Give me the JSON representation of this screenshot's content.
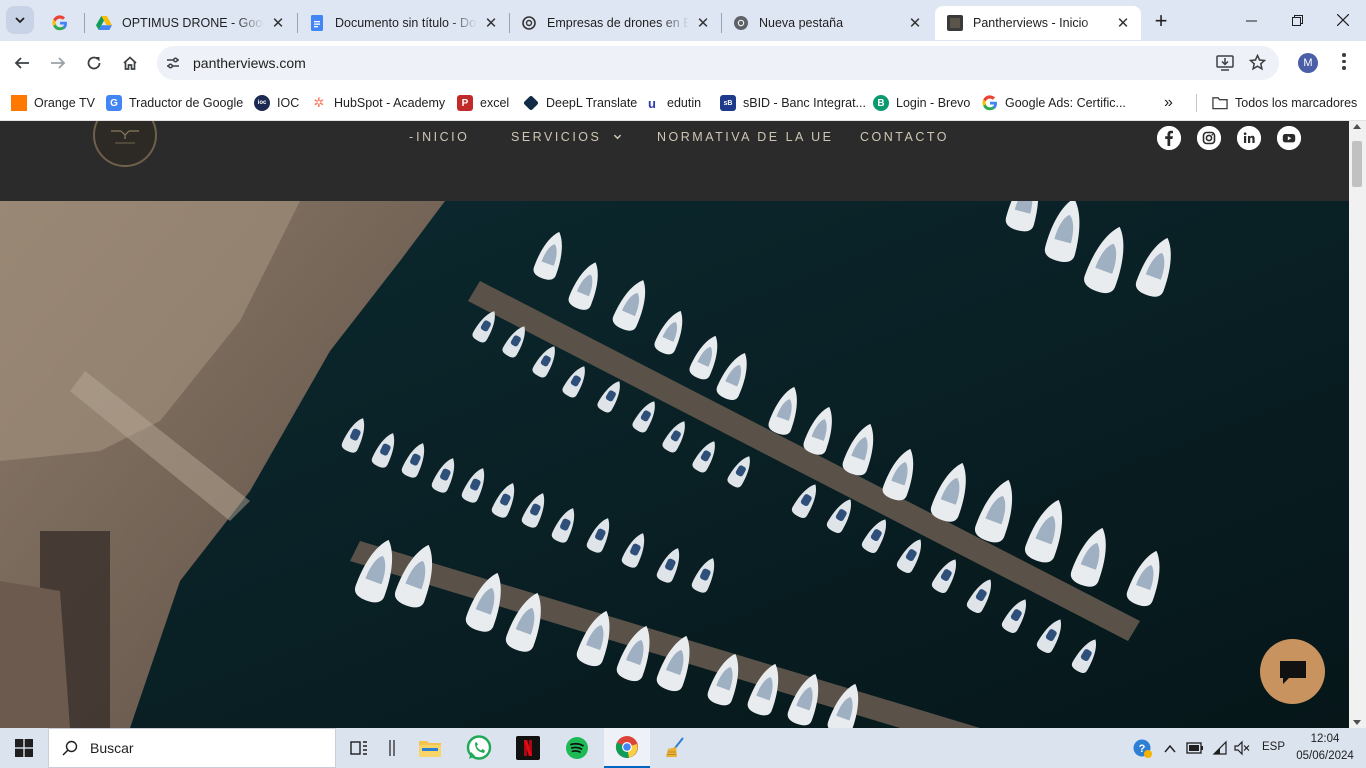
{
  "tabs": [
    {
      "title": "",
      "icon": "google-icon"
    },
    {
      "title": "OPTIMUS DRONE - Google Drive",
      "icon": "google-drive-icon"
    },
    {
      "title": "Documento sin título - Documentos de Google",
      "icon": "google-docs-icon"
    },
    {
      "title": "Empresas de drones en Bilbao",
      "icon": "chatgpt-icon"
    },
    {
      "title": "Nueva pestaña",
      "icon": "chrome-icon"
    },
    {
      "title": "Pantherviews - Inicio",
      "icon": "pantherviews-icon"
    }
  ],
  "toolbar": {
    "url": "pantherviews.com",
    "avatar_letter": "M"
  },
  "bookmarks": {
    "items": [
      {
        "label": "Orange TV",
        "color": "#ff7900"
      },
      {
        "label": "Traductor de Google",
        "color": "#4285f4"
      },
      {
        "label": "IOC",
        "color": "#1c2a52"
      },
      {
        "label": "HubSpot - Academy",
        "color": "#ff7a59"
      },
      {
        "label": "excel",
        "color": "#c22a2a"
      },
      {
        "label": "DeepL Translate",
        "color": "#0f2b46"
      },
      {
        "label": "edutin",
        "color": "#2a3bb0"
      },
      {
        "label": "sBID - Banc Integrat...",
        "color": "#1d3b8a"
      },
      {
        "label": "Login - Brevo",
        "color": "#0b996e"
      },
      {
        "label": "Google Ads: Certific...",
        "color": "#fbbc04"
      }
    ],
    "all_label": "Todos los marcadores"
  },
  "site": {
    "nav": {
      "inicio": "INICIO",
      "servicios": "SERVICIOS",
      "normativa": "NORMATIVA DE LA UE",
      "contacto": "CONTACTO"
    },
    "colors": {
      "header_bg": "#2b2b2b",
      "nav_text": "#cfc7b4",
      "chat_button": "#c8935f"
    }
  },
  "taskbar": {
    "search_placeholder": "Buscar",
    "language": "ESP",
    "time": "12:04",
    "date": "05/06/2024"
  }
}
